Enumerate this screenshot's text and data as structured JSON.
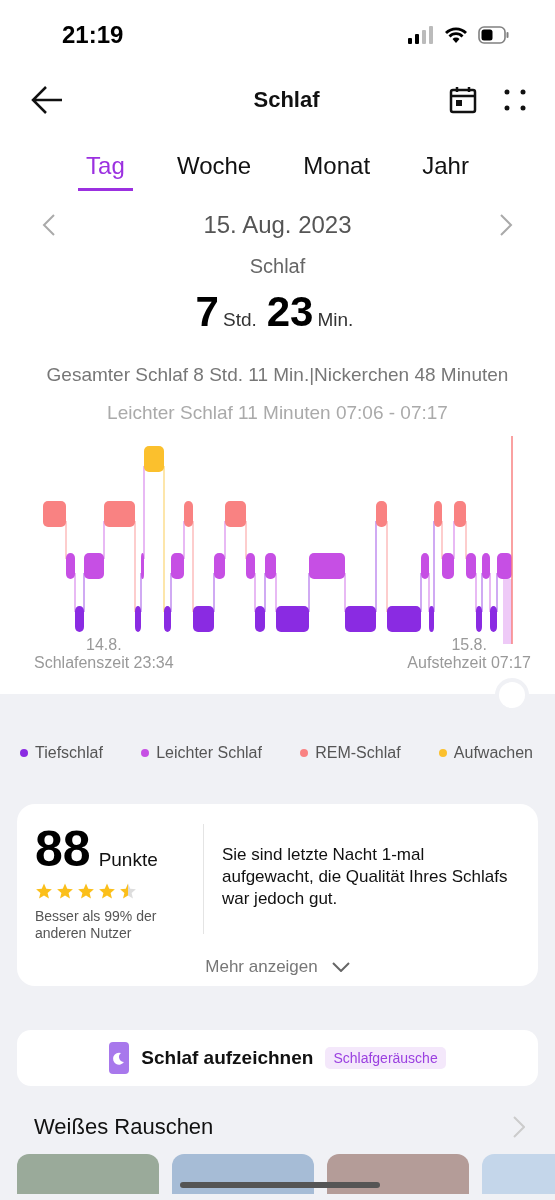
{
  "status_bar": {
    "time": "21:19"
  },
  "header": {
    "title": "Schlaf"
  },
  "tabs": [
    {
      "label": "Tag",
      "selected": true
    },
    {
      "label": "Woche",
      "selected": false
    },
    {
      "label": "Monat",
      "selected": false
    },
    {
      "label": "Jahr",
      "selected": false
    }
  ],
  "date_nav": {
    "date": "15. Aug. 2023"
  },
  "summary": {
    "label": "Schlaf",
    "hours": "7",
    "hours_unit": "Std.",
    "minutes": "23",
    "minutes_unit": "Min.",
    "totals": "Gesamter Schlaf 8 Std. 11 Min.|Nickerchen 48 Minuten"
  },
  "chart": {
    "caption": "Leichter Schlaf 11 Minuten 07:06 - 07:17",
    "start": {
      "date": "14.8.",
      "label": "Schlafenszeit 23:34"
    },
    "end": {
      "date": "15.8.",
      "label": "Aufstehzeit 07:17"
    }
  },
  "legend": [
    {
      "label": "Tiefschlaf",
      "color": "#8a2be2"
    },
    {
      "label": "Leichter Schlaf",
      "color": "#c64fe4"
    },
    {
      "label": "REM-Schlaf",
      "color": "#f98282"
    },
    {
      "label": "Aufwachen",
      "color": "#fbc02d"
    }
  ],
  "score": {
    "value": "88",
    "unit": "Punkte",
    "stars": 4.5,
    "comparison": "Besser als 99% der anderen Nutzer",
    "message": "Sie sind letzte Nacht 1-mal aufgewacht, die Qualität Ihres Schlafs war jedoch gut.",
    "more": "Mehr anzeigen"
  },
  "record": {
    "label": "Schlaf aufzeichnen",
    "tag": "Schlafgeräusche"
  },
  "white_noise": {
    "title": "Weißes Rauschen"
  }
}
